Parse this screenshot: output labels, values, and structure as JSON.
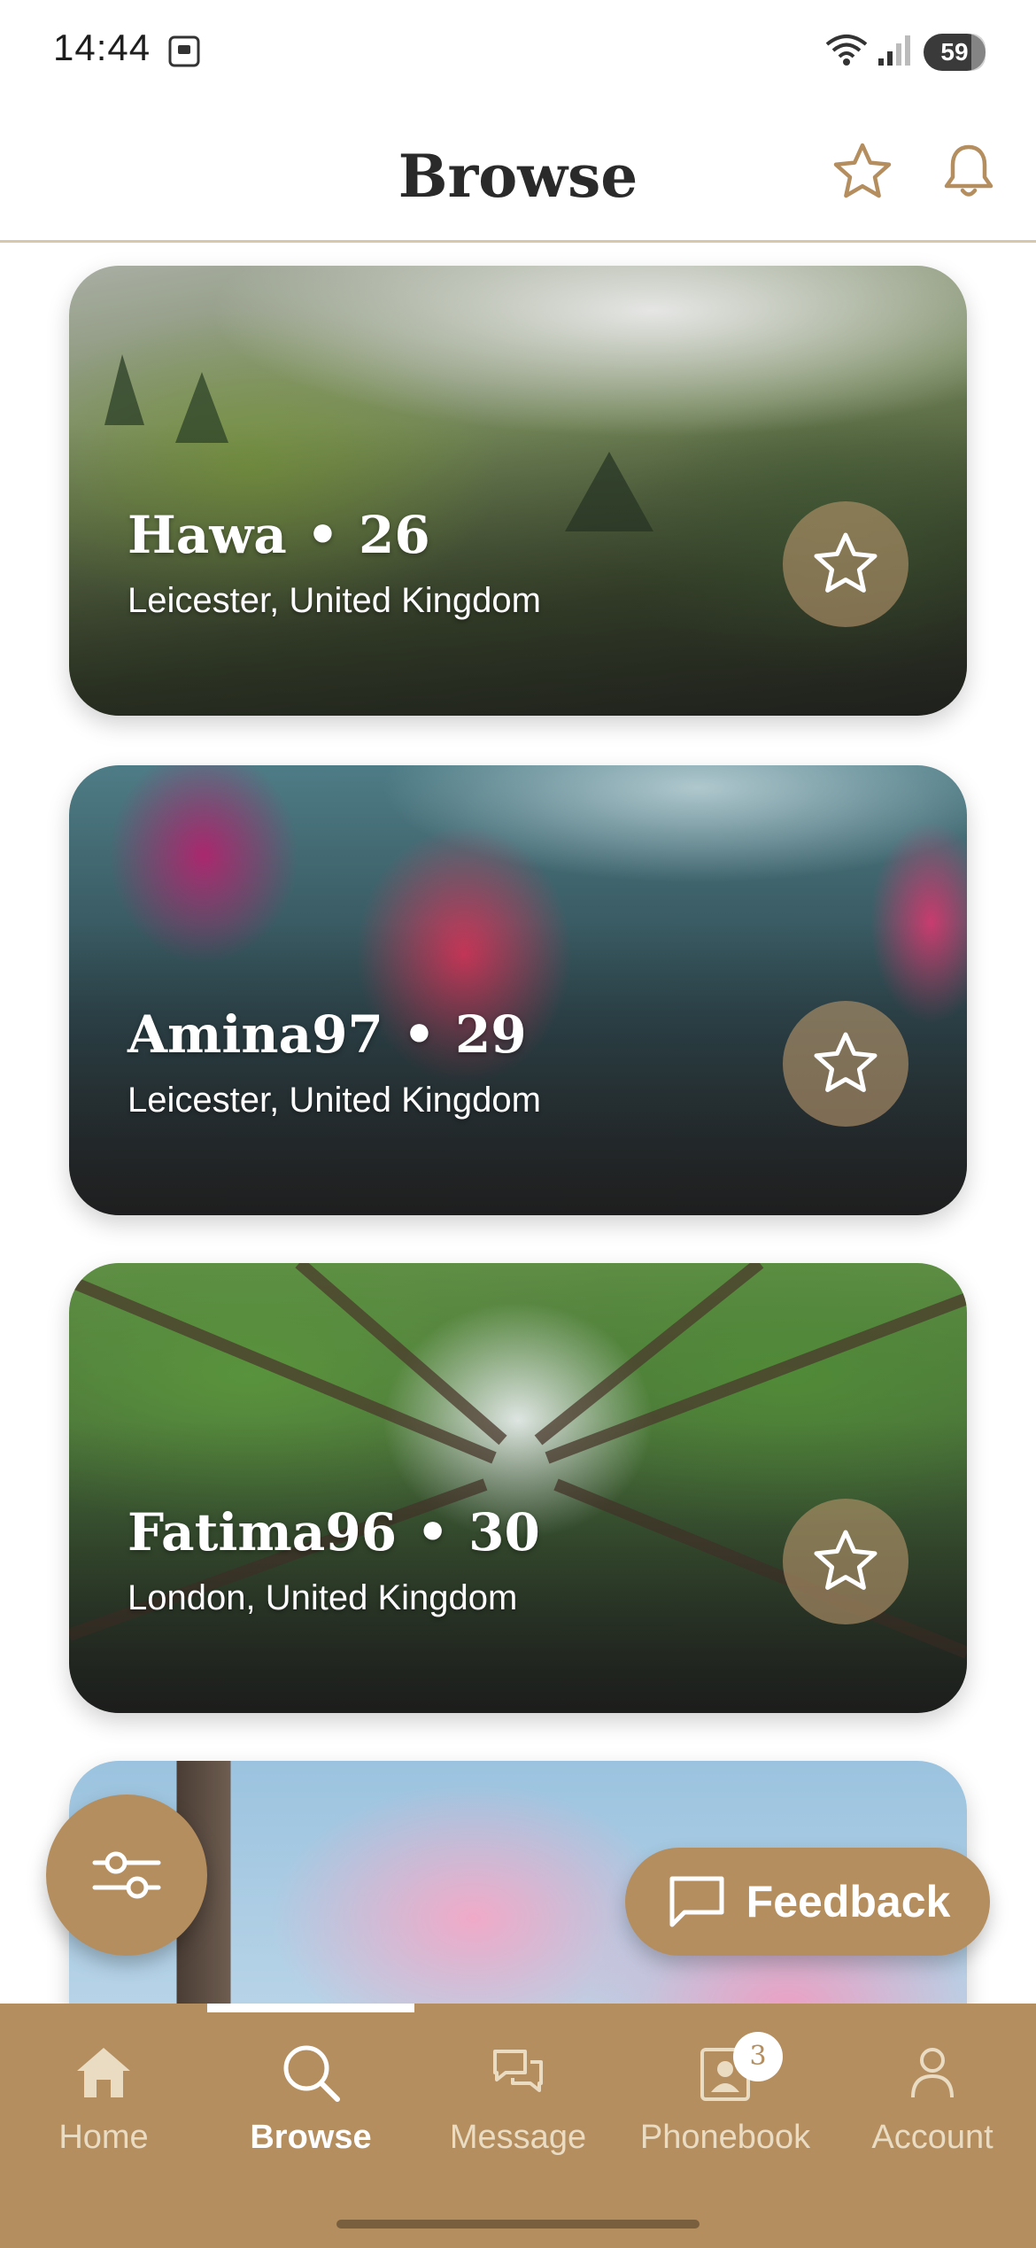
{
  "status_bar": {
    "time": "14:44",
    "battery": "59"
  },
  "header": {
    "title": "Browse",
    "icons": [
      "star-icon",
      "bell-icon"
    ]
  },
  "profiles": [
    {
      "name": "Hawa",
      "age": "26",
      "location": "Leicester, United Kingdom",
      "photo": "misty forest"
    },
    {
      "name": "Amina97",
      "age": "29",
      "location": "Leicester, United Kingdom",
      "photo": "pink tulips"
    },
    {
      "name": "Fatima96",
      "age": "30",
      "location": "London, United Kingdom",
      "photo": "forest canopy"
    },
    {
      "photo": "cherry blossoms"
    }
  ],
  "separator": "•",
  "feedback": {
    "label": "Feedback"
  },
  "nav": {
    "items": [
      {
        "label": "Home",
        "icon": "home-icon"
      },
      {
        "label": "Browse",
        "icon": "search-icon",
        "active": true
      },
      {
        "label": "Message",
        "icon": "chat-icon"
      },
      {
        "label": "Phonebook",
        "icon": "contact-book-icon",
        "badge": "3"
      },
      {
        "label": "Account",
        "icon": "person-icon"
      }
    ]
  },
  "colors": {
    "accent": "#b48e5f",
    "header_rule": "#d9c7a9",
    "title": "#2a2a2a"
  }
}
